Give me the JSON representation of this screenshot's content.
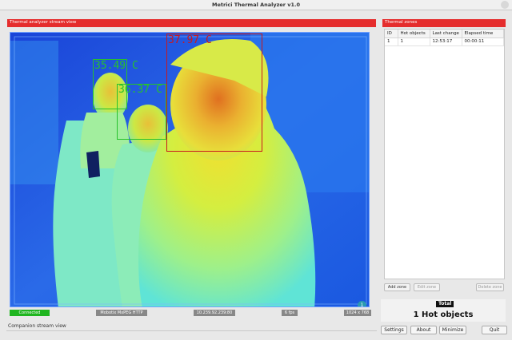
{
  "window": {
    "title": "Metrici Thermal Analyzer v1.0"
  },
  "stream": {
    "header": "Thermal analyzer stream view",
    "zones": [
      {
        "temp": "37.97 C",
        "color": "#c8191e"
      },
      {
        "temp": "35.49 C",
        "color": "#27c12c"
      },
      {
        "temp": "36.37 C",
        "color": "#27c12c"
      }
    ],
    "badge": "1"
  },
  "status": {
    "connection": "Connected",
    "protocol": "Mobotix MxPEG HTTP",
    "ip": "10.239.92.239:80",
    "fps": "6 fps",
    "resolution": "1024 x 768",
    "connected_color": "#1fb51f"
  },
  "companion": {
    "label": "Companion stream view"
  },
  "zones_panel": {
    "header": "Thermal zones",
    "columns": [
      "ID",
      "Hot objects",
      "Last change",
      "Elapsed time"
    ],
    "rows": [
      {
        "id": "1",
        "hot": "1",
        "last": "12:53:17",
        "elapsed": "00:00:11"
      }
    ],
    "buttons": {
      "add": "Add zone",
      "edit": "Edit zone",
      "delete": "Delete zone"
    }
  },
  "total": {
    "label": "Total",
    "value": "1 Hot objects"
  },
  "bottom": {
    "settings": "Settings",
    "about": "About",
    "minimize": "Minimize",
    "quit": "Quit"
  },
  "colors": {
    "header_red": "#e52d2d",
    "zone_red": "#c8191e",
    "zone_green": "#27c12c"
  }
}
